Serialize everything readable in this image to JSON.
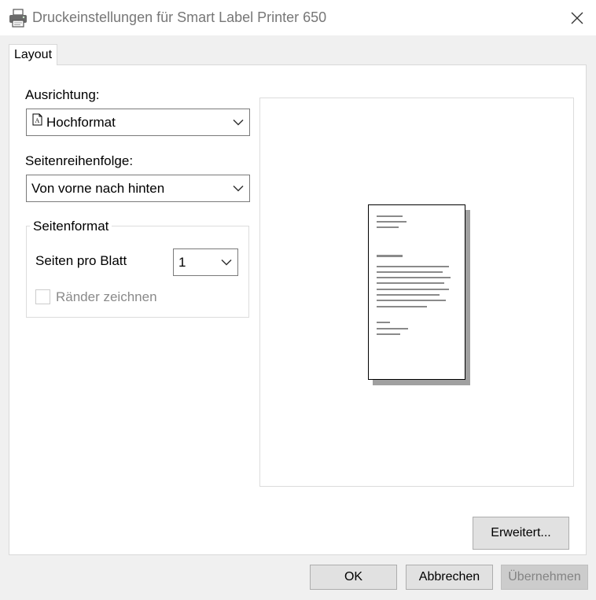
{
  "window": {
    "title": "Druckeinstellungen für Smart Label Printer 650"
  },
  "tabs": [
    {
      "label": "Layout",
      "selected": true
    }
  ],
  "orientation": {
    "label": "Ausrichtung:",
    "value": "Hochformat",
    "icon": "portrait-page-icon"
  },
  "page_order": {
    "label": "Seitenreihenfolge:",
    "value": "Von vorne nach hinten"
  },
  "page_format": {
    "legend": "Seitenformat",
    "pages_per_sheet_label": "Seiten pro Blatt",
    "pages_per_sheet_value": "1",
    "draw_borders_label": "Ränder zeichnen",
    "draw_borders_checked": false,
    "draw_borders_enabled": false
  },
  "buttons": {
    "advanced": "Erweitert...",
    "ok": "OK",
    "cancel": "Abbrechen",
    "apply": "Übernehmen"
  }
}
